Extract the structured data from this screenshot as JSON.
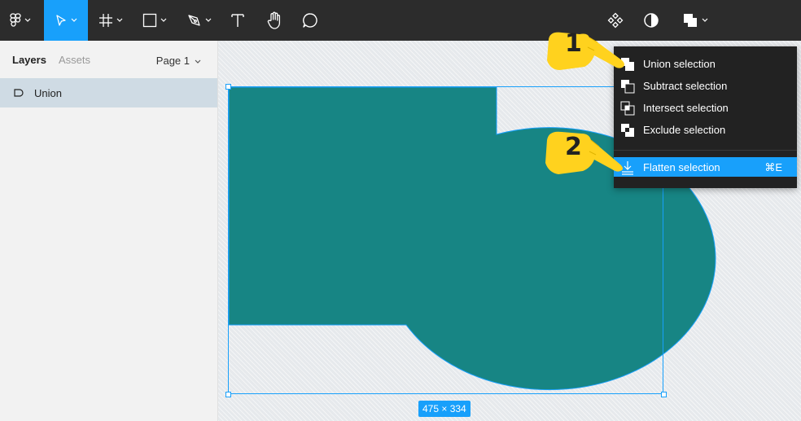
{
  "toolbar": {
    "tools": [
      {
        "name": "main-menu",
        "icon": "figma-logo-icon"
      },
      {
        "name": "move-tool",
        "icon": "cursor-icon",
        "active": true
      },
      {
        "name": "frame-tool",
        "icon": "frame-hash-icon"
      },
      {
        "name": "shape-tool",
        "icon": "rectangle-icon"
      },
      {
        "name": "pen-tool",
        "icon": "pen-icon"
      },
      {
        "name": "text-tool",
        "icon": "text-icon"
      },
      {
        "name": "hand-tool",
        "icon": "hand-icon"
      },
      {
        "name": "comment-tool",
        "icon": "comment-icon"
      }
    ],
    "right_tools": [
      {
        "name": "component",
        "icon": "component-icon"
      },
      {
        "name": "mask",
        "icon": "mask-icon"
      },
      {
        "name": "boolean-groups",
        "icon": "boolean-icon"
      }
    ]
  },
  "left_panel": {
    "tabs": {
      "layers": "Layers",
      "assets": "Assets"
    },
    "page_selector": "Page 1",
    "layers": [
      {
        "label": "Union",
        "icon": "boolean-union-icon",
        "selected": true
      }
    ]
  },
  "canvas": {
    "shape_color": "#178584",
    "selection_color": "#18a0fb",
    "dimensions_label": "475 × 334"
  },
  "menu": {
    "items": [
      {
        "label": "Union selection",
        "icon": "union-icon"
      },
      {
        "label": "Subtract selection",
        "icon": "subtract-icon"
      },
      {
        "label": "Intersect selection",
        "icon": "intersect-icon"
      },
      {
        "label": "Exclude selection",
        "icon": "exclude-icon"
      }
    ],
    "flatten": {
      "label": "Flatten selection",
      "shortcut": "⌘E",
      "icon": "flatten-icon",
      "highlighted": true
    }
  },
  "callouts": [
    {
      "number": "1",
      "color": "#ffd21e"
    },
    {
      "number": "2",
      "color": "#ffd21e"
    }
  ]
}
